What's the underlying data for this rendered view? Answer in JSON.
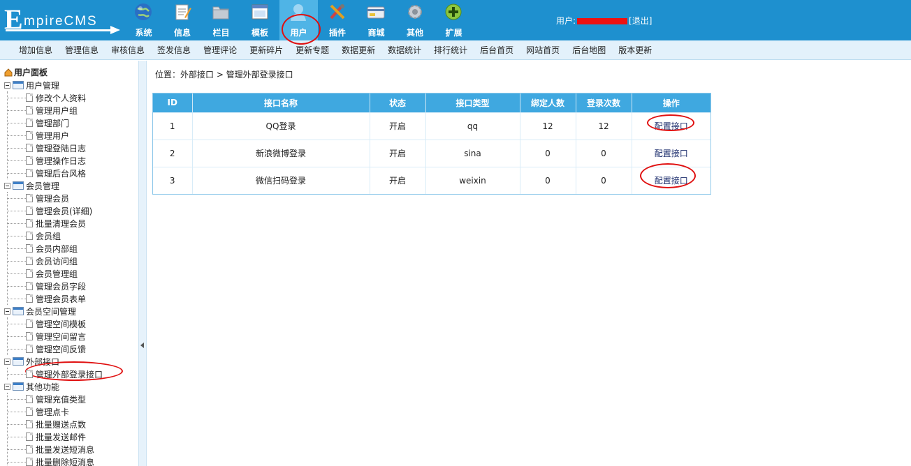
{
  "brand": {
    "letter": "E",
    "rest": "mpireCMS"
  },
  "nav": [
    {
      "label": "系统",
      "icon": "globe-icon"
    },
    {
      "label": "信息",
      "icon": "notepad-icon"
    },
    {
      "label": "栏目",
      "icon": "folder-icon"
    },
    {
      "label": "模板",
      "icon": "window-icon"
    },
    {
      "label": "用户",
      "icon": "user-icon",
      "active": true
    },
    {
      "label": "插件",
      "icon": "tools-icon"
    },
    {
      "label": "商城",
      "icon": "card-icon"
    },
    {
      "label": "其他",
      "icon": "gear-icon"
    },
    {
      "label": "扩展",
      "icon": "plus-icon"
    }
  ],
  "userbar": {
    "prefix": "用户:",
    "logout": "[退出]"
  },
  "subnav": [
    "增加信息",
    "管理信息",
    "审核信息",
    "签发信息",
    "管理评论",
    "更新碎片",
    "更新专题",
    "数据更新",
    "数据统计",
    "排行统计",
    "后台首页",
    "网站首页",
    "后台地图",
    "版本更新"
  ],
  "sidebar": {
    "title": "用户面板",
    "groups": [
      {
        "title": "用户管理",
        "items": [
          "修改个人资料",
          "管理用户组",
          "管理部门",
          "管理用户",
          "管理登陆日志",
          "管理操作日志",
          "管理后台风格"
        ]
      },
      {
        "title": "会员管理",
        "items": [
          "管理会员",
          "管理会员(详细)",
          "批量清理会员",
          "会员组",
          "会员内部组",
          "会员访问组",
          "会员管理组",
          "管理会员字段",
          "管理会员表单"
        ]
      },
      {
        "title": "会员空间管理",
        "items": [
          "管理空间模板",
          "管理空间留言",
          "管理空间反馈"
        ]
      },
      {
        "title": "外部接口",
        "items": [
          "管理外部登录接口"
        ]
      },
      {
        "title": "其他功能",
        "items": [
          "管理充值类型",
          "管理点卡",
          "批量赠送点数",
          "批量发送邮件",
          "批量发送短消息",
          "批量删除短消息"
        ]
      }
    ]
  },
  "breadcrumb": "位置：外部接口 > 管理外部登录接口",
  "table": {
    "headers": [
      "ID",
      "接口名称",
      "状态",
      "接口类型",
      "绑定人数",
      "登录次数",
      "操作"
    ],
    "rows": [
      [
        "1",
        "QQ登录",
        "开启",
        "qq",
        "12",
        "12",
        "配置接口"
      ],
      [
        "2",
        "新浪微博登录",
        "开启",
        "sina",
        "0",
        "0",
        "配置接口"
      ],
      [
        "3",
        "微信扫码登录",
        "开启",
        "weixin",
        "0",
        "0",
        "配置接口"
      ]
    ]
  },
  "colors": {
    "header": "#1e90cf",
    "active_nav": "#4fb4e6",
    "table_header": "#3fa8e0",
    "annotation": "#e01010"
  }
}
